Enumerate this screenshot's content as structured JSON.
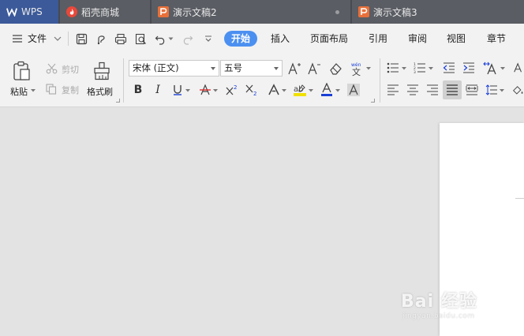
{
  "tabs": {
    "wps": "WPS",
    "tab1": "稻壳商城",
    "tab2": "演示文稿2",
    "tab3": "演示文稿3"
  },
  "menu": {
    "file": "文件",
    "items": [
      "开始",
      "插入",
      "页面布局",
      "引用",
      "审阅",
      "视图",
      "章节"
    ],
    "active": "开始"
  },
  "ribbon": {
    "paste": "粘贴",
    "cut": "剪切",
    "copy": "复制",
    "format_painter": "格式刷",
    "font_name": "宋体 (正文)",
    "font_size": "五号"
  },
  "watermark": {
    "text": "Bai 经验",
    "url": "jingyan.baidu.com"
  },
  "colors": {
    "tabbar": "#474a50",
    "accent": "#4b90f0",
    "highlight_yellow": "#f0e000",
    "font_color_blue": "#1a3fd6"
  }
}
